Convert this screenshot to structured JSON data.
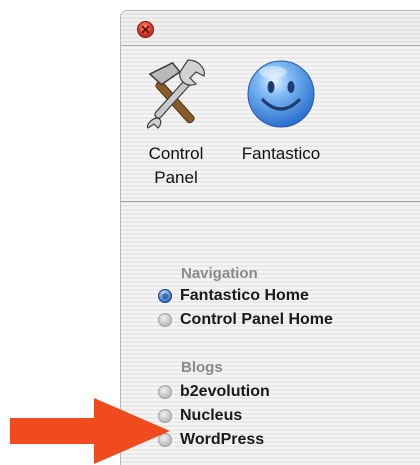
{
  "window": {
    "close_button": "close"
  },
  "toolbar": {
    "control_panel": {
      "line1": "Control",
      "line2": "Panel",
      "icon": "tools-icon"
    },
    "fantastico": {
      "label": "Fantastico",
      "icon": "smiley-icon"
    }
  },
  "sidebar": {
    "navigation": {
      "title": "Navigation",
      "items": [
        {
          "label": "Fantastico Home",
          "selected": true
        },
        {
          "label": "Control Panel Home",
          "selected": false
        }
      ]
    },
    "blogs": {
      "title": "Blogs",
      "items": [
        {
          "label": "b2evolution",
          "selected": false
        },
        {
          "label": "Nucleus",
          "selected": false
        },
        {
          "label": "WordPress",
          "selected": false
        }
      ]
    }
  },
  "overlay": {
    "arrow_color": "#f04a1f",
    "arrow_icon": "pointer-arrow-icon"
  },
  "colors": {
    "radio_selected": "#3a7fd5",
    "section_title": "#8a8a8a",
    "close_button": "#e0412d"
  }
}
